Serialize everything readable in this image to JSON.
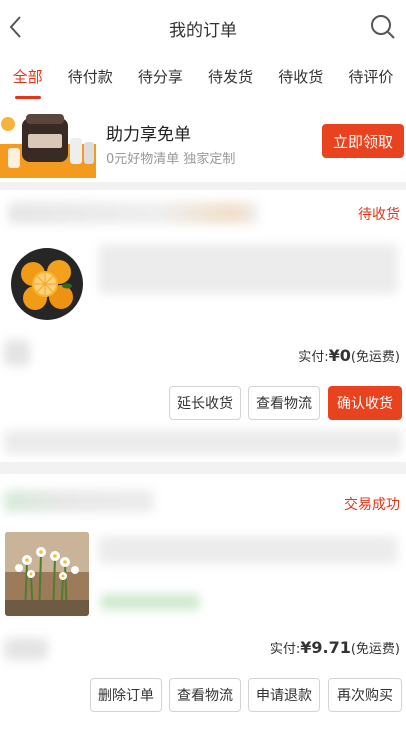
{
  "header": {
    "title": "我的订单",
    "back_icon": "chevron-left-icon",
    "search_icon": "search-icon"
  },
  "tabs": [
    {
      "label": "全部",
      "active": true
    },
    {
      "label": "待付款"
    },
    {
      "label": "待分享"
    },
    {
      "label": "待发货"
    },
    {
      "label": "待收货"
    },
    {
      "label": "待评价"
    }
  ],
  "promo": {
    "title": "助力享免单",
    "subtitle": "0元好物清单 独家定制",
    "button": "立即领取"
  },
  "orders": [
    {
      "status": "待收货",
      "payment": {
        "label": "实付:",
        "amount": "¥0",
        "note": "(免运费)"
      },
      "buttons": [
        "延长收货",
        "查看物流"
      ],
      "primary_button": "确认收货"
    },
    {
      "status": "交易成功",
      "payment": {
        "label": "实付:",
        "amount": "¥9.71",
        "note": "(免运费)"
      },
      "buttons": [
        "删除订单",
        "查看物流",
        "申请退款",
        "再次购买"
      ]
    }
  ],
  "colors": {
    "accent": "#e2361a",
    "button_red": "#e8421f"
  }
}
